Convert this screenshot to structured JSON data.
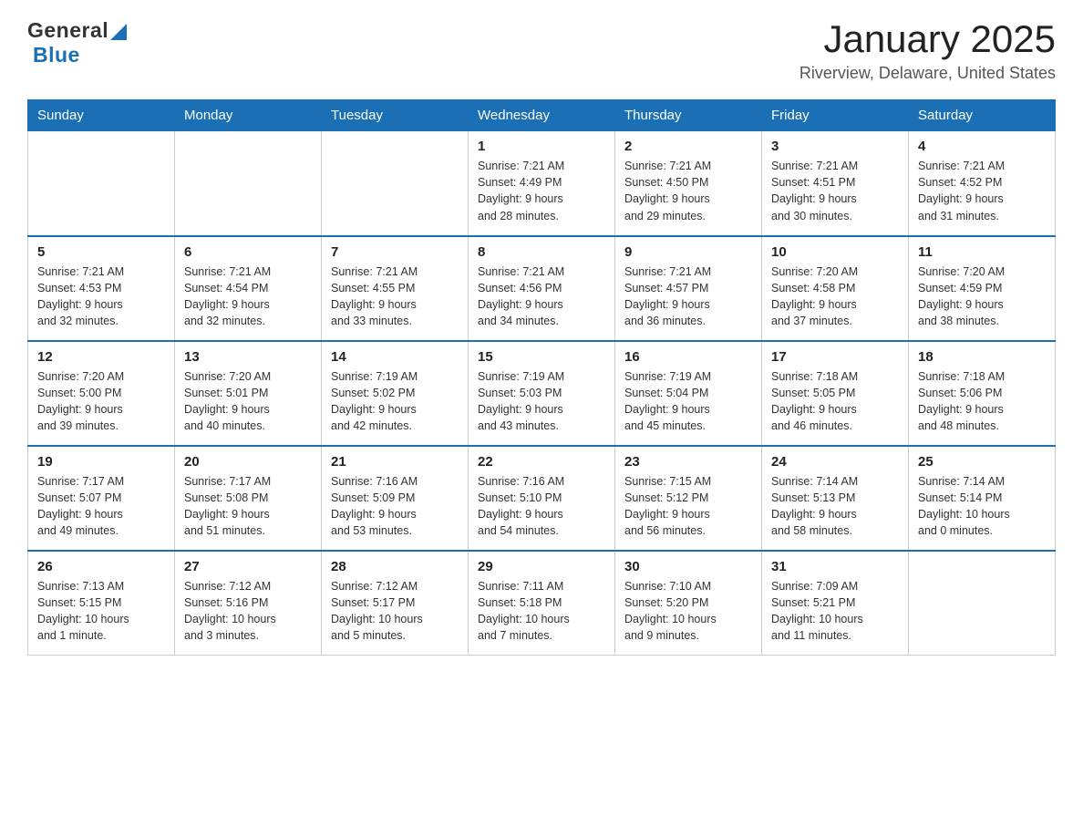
{
  "header": {
    "logo_general": "General",
    "logo_blue": "Blue",
    "title": "January 2025",
    "subtitle": "Riverview, Delaware, United States"
  },
  "days_of_week": [
    "Sunday",
    "Monday",
    "Tuesday",
    "Wednesday",
    "Thursday",
    "Friday",
    "Saturday"
  ],
  "weeks": [
    [
      {
        "day": "",
        "info": ""
      },
      {
        "day": "",
        "info": ""
      },
      {
        "day": "",
        "info": ""
      },
      {
        "day": "1",
        "info": "Sunrise: 7:21 AM\nSunset: 4:49 PM\nDaylight: 9 hours\nand 28 minutes."
      },
      {
        "day": "2",
        "info": "Sunrise: 7:21 AM\nSunset: 4:50 PM\nDaylight: 9 hours\nand 29 minutes."
      },
      {
        "day": "3",
        "info": "Sunrise: 7:21 AM\nSunset: 4:51 PM\nDaylight: 9 hours\nand 30 minutes."
      },
      {
        "day": "4",
        "info": "Sunrise: 7:21 AM\nSunset: 4:52 PM\nDaylight: 9 hours\nand 31 minutes."
      }
    ],
    [
      {
        "day": "5",
        "info": "Sunrise: 7:21 AM\nSunset: 4:53 PM\nDaylight: 9 hours\nand 32 minutes."
      },
      {
        "day": "6",
        "info": "Sunrise: 7:21 AM\nSunset: 4:54 PM\nDaylight: 9 hours\nand 32 minutes."
      },
      {
        "day": "7",
        "info": "Sunrise: 7:21 AM\nSunset: 4:55 PM\nDaylight: 9 hours\nand 33 minutes."
      },
      {
        "day": "8",
        "info": "Sunrise: 7:21 AM\nSunset: 4:56 PM\nDaylight: 9 hours\nand 34 minutes."
      },
      {
        "day": "9",
        "info": "Sunrise: 7:21 AM\nSunset: 4:57 PM\nDaylight: 9 hours\nand 36 minutes."
      },
      {
        "day": "10",
        "info": "Sunrise: 7:20 AM\nSunset: 4:58 PM\nDaylight: 9 hours\nand 37 minutes."
      },
      {
        "day": "11",
        "info": "Sunrise: 7:20 AM\nSunset: 4:59 PM\nDaylight: 9 hours\nand 38 minutes."
      }
    ],
    [
      {
        "day": "12",
        "info": "Sunrise: 7:20 AM\nSunset: 5:00 PM\nDaylight: 9 hours\nand 39 minutes."
      },
      {
        "day": "13",
        "info": "Sunrise: 7:20 AM\nSunset: 5:01 PM\nDaylight: 9 hours\nand 40 minutes."
      },
      {
        "day": "14",
        "info": "Sunrise: 7:19 AM\nSunset: 5:02 PM\nDaylight: 9 hours\nand 42 minutes."
      },
      {
        "day": "15",
        "info": "Sunrise: 7:19 AM\nSunset: 5:03 PM\nDaylight: 9 hours\nand 43 minutes."
      },
      {
        "day": "16",
        "info": "Sunrise: 7:19 AM\nSunset: 5:04 PM\nDaylight: 9 hours\nand 45 minutes."
      },
      {
        "day": "17",
        "info": "Sunrise: 7:18 AM\nSunset: 5:05 PM\nDaylight: 9 hours\nand 46 minutes."
      },
      {
        "day": "18",
        "info": "Sunrise: 7:18 AM\nSunset: 5:06 PM\nDaylight: 9 hours\nand 48 minutes."
      }
    ],
    [
      {
        "day": "19",
        "info": "Sunrise: 7:17 AM\nSunset: 5:07 PM\nDaylight: 9 hours\nand 49 minutes."
      },
      {
        "day": "20",
        "info": "Sunrise: 7:17 AM\nSunset: 5:08 PM\nDaylight: 9 hours\nand 51 minutes."
      },
      {
        "day": "21",
        "info": "Sunrise: 7:16 AM\nSunset: 5:09 PM\nDaylight: 9 hours\nand 53 minutes."
      },
      {
        "day": "22",
        "info": "Sunrise: 7:16 AM\nSunset: 5:10 PM\nDaylight: 9 hours\nand 54 minutes."
      },
      {
        "day": "23",
        "info": "Sunrise: 7:15 AM\nSunset: 5:12 PM\nDaylight: 9 hours\nand 56 minutes."
      },
      {
        "day": "24",
        "info": "Sunrise: 7:14 AM\nSunset: 5:13 PM\nDaylight: 9 hours\nand 58 minutes."
      },
      {
        "day": "25",
        "info": "Sunrise: 7:14 AM\nSunset: 5:14 PM\nDaylight: 10 hours\nand 0 minutes."
      }
    ],
    [
      {
        "day": "26",
        "info": "Sunrise: 7:13 AM\nSunset: 5:15 PM\nDaylight: 10 hours\nand 1 minute."
      },
      {
        "day": "27",
        "info": "Sunrise: 7:12 AM\nSunset: 5:16 PM\nDaylight: 10 hours\nand 3 minutes."
      },
      {
        "day": "28",
        "info": "Sunrise: 7:12 AM\nSunset: 5:17 PM\nDaylight: 10 hours\nand 5 minutes."
      },
      {
        "day": "29",
        "info": "Sunrise: 7:11 AM\nSunset: 5:18 PM\nDaylight: 10 hours\nand 7 minutes."
      },
      {
        "day": "30",
        "info": "Sunrise: 7:10 AM\nSunset: 5:20 PM\nDaylight: 10 hours\nand 9 minutes."
      },
      {
        "day": "31",
        "info": "Sunrise: 7:09 AM\nSunset: 5:21 PM\nDaylight: 10 hours\nand 11 minutes."
      },
      {
        "day": "",
        "info": ""
      }
    ]
  ]
}
